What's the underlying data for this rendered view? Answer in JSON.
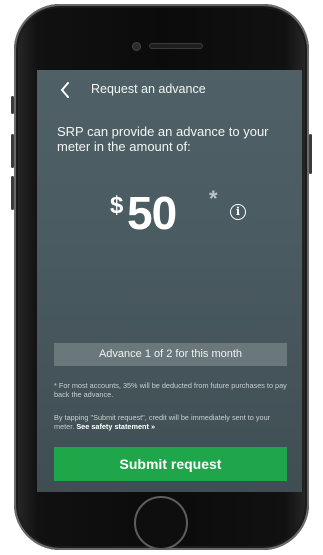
{
  "header": {
    "title": "Request an advance"
  },
  "intro": {
    "text": "SRP can provide an advance to your meter in the amount of:"
  },
  "amount": {
    "currency": "$",
    "value": "50",
    "asterisk": "*"
  },
  "counter": {
    "text": "Advance 1 of 2 for this month"
  },
  "disclaimer": {
    "deduction": "* For most accounts, 35% will be deducted from future purchases to pay back the advance.",
    "tapping": "By tapping \"Submit request\", credit will be immediately sent to your meter.",
    "link": "See safety statement »"
  },
  "submit": {
    "label": "Submit request"
  },
  "colors": {
    "accent": "#1fa64a",
    "screen_bg": "#4a5b61"
  },
  "icons": {
    "back": "chevron-left-icon",
    "info": "info-icon"
  }
}
